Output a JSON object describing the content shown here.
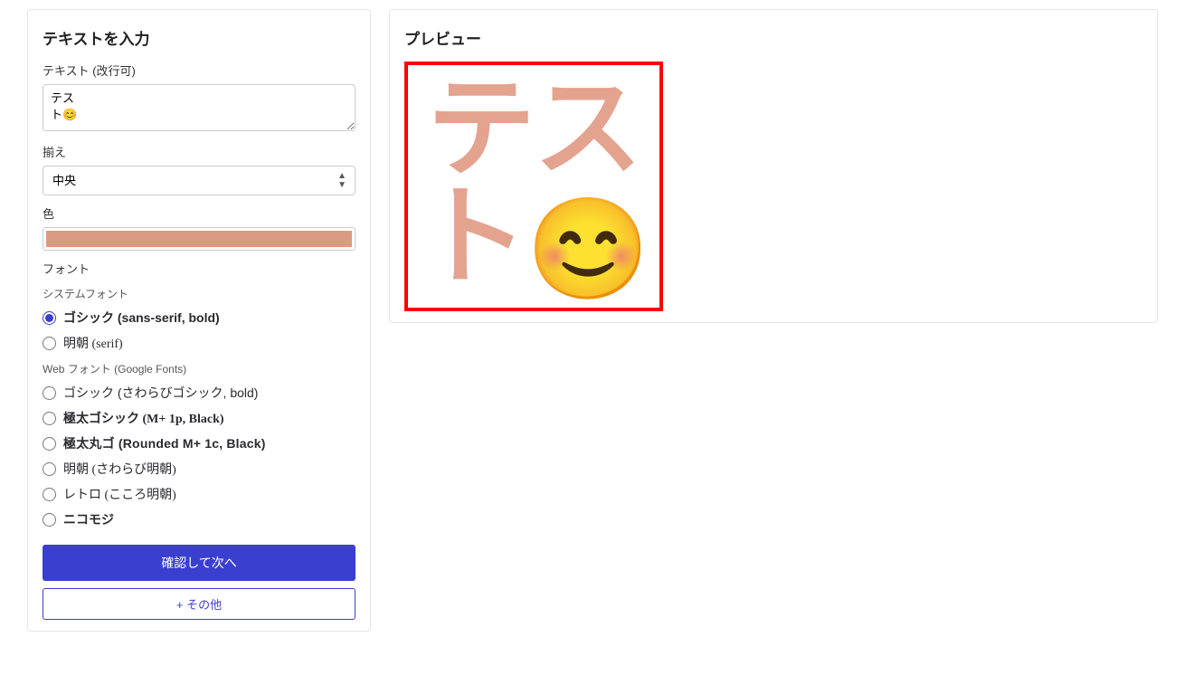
{
  "left": {
    "title": "テキストを入力",
    "text_label": "テキスト (改行可)",
    "text_value": "テス\nト😊",
    "align_label": "揃え",
    "align_value": "中央",
    "color_label": "色",
    "color_value": "#dd9a82",
    "font_label": "フォント",
    "system_fonts_label": "システムフォント",
    "web_fonts_label": "Web フォント (Google Fonts)",
    "fonts": {
      "gothic_bold": "ゴシック (sans-serif, bold)",
      "mincho_serif": "明朝 (serif)",
      "sawarabi_gothic": "ゴシック (さわらびゴシック, bold)",
      "mplus_black": "極太ゴシック (M+ 1p, Black)",
      "rounded_black": "極太丸ゴ (Rounded M+ 1c, Black)",
      "sawarabi_mincho": "明朝 (さわらび明朝)",
      "kokoro_mincho": "レトロ (こころ明朝)",
      "nicomoji": "ニコモジ"
    },
    "confirm_button": "確認して次へ",
    "more_button": "+ その他"
  },
  "preview": {
    "title": "プレビュー",
    "line1": "テス",
    "line2_text": "ト",
    "line2_emoji": "😊"
  }
}
